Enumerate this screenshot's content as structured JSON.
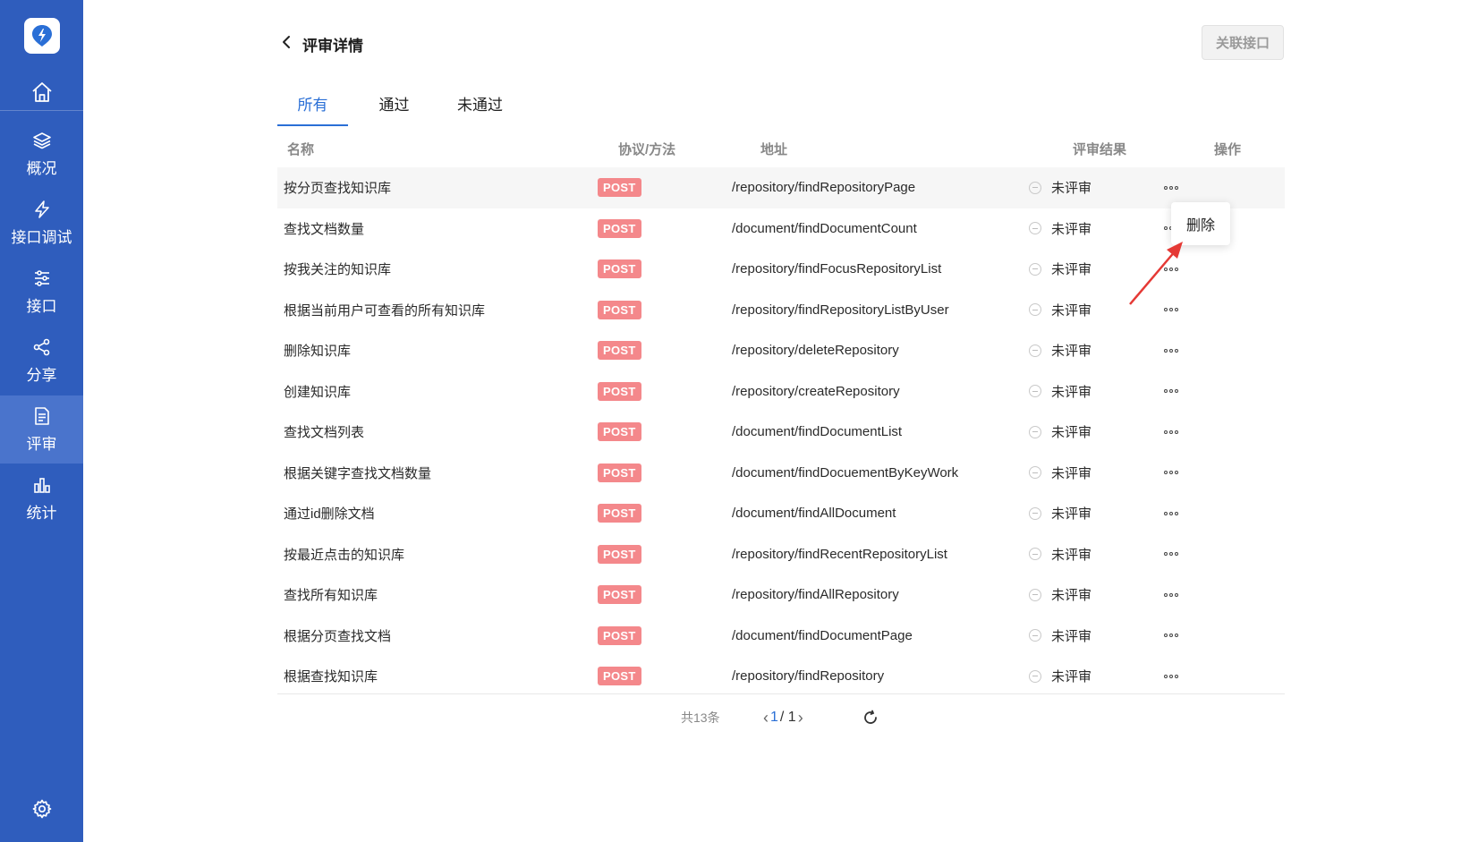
{
  "sidebar": {
    "items": [
      {
        "label": "概况",
        "icon": "layers-icon"
      },
      {
        "label": "接口调试",
        "icon": "lightning-icon"
      },
      {
        "label": "接口",
        "icon": "sliders-icon"
      },
      {
        "label": "分享",
        "icon": "share-icon"
      },
      {
        "label": "评审",
        "icon": "document-list-icon"
      },
      {
        "label": "统计",
        "icon": "bar-chart-icon"
      }
    ],
    "active_item": "评审"
  },
  "header": {
    "title": "评审详情",
    "link_button_label": "关联接口"
  },
  "tabs": [
    "所有",
    "通过",
    "未通过"
  ],
  "active_tab": "所有",
  "table": {
    "headers": {
      "name": "名称",
      "method": "协议/方法",
      "address": "地址",
      "result": "评审结果",
      "action": "操作"
    },
    "rows": [
      {
        "name": "按分页查找知识库",
        "method": "POST",
        "address": "/repository/findRepositoryPage",
        "result": "未评审"
      },
      {
        "name": "查找文档数量",
        "method": "POST",
        "address": "/document/findDocumentCount",
        "result": "未评审"
      },
      {
        "name": "按我关注的知识库",
        "method": "POST",
        "address": "/repository/findFocusRepositoryList",
        "result": "未评审"
      },
      {
        "name": "根据当前用户可查看的所有知识库",
        "method": "POST",
        "address": "/repository/findRepositoryListByUser",
        "result": "未评审"
      },
      {
        "name": "删除知识库",
        "method": "POST",
        "address": "/repository/deleteRepository",
        "result": "未评审"
      },
      {
        "name": "创建知识库",
        "method": "POST",
        "address": "/repository/createRepository",
        "result": "未评审"
      },
      {
        "name": "查找文档列表",
        "method": "POST",
        "address": "/document/findDocumentList",
        "result": "未评审"
      },
      {
        "name": "根据关键字查找文档数量",
        "method": "POST",
        "address": "/document/findDocuementByKeyWork",
        "result": "未评审"
      },
      {
        "name": "通过id删除文档",
        "method": "POST",
        "address": "/document/findAllDocument",
        "result": "未评审"
      },
      {
        "name": "按最近点击的知识库",
        "method": "POST",
        "address": "/repository/findRecentRepositoryList",
        "result": "未评审"
      },
      {
        "name": "查找所有知识库",
        "method": "POST",
        "address": "/repository/findAllRepository",
        "result": "未评审"
      },
      {
        "name": "根据分页查找文档",
        "method": "POST",
        "address": "/document/findDocumentPage",
        "result": "未评审"
      },
      {
        "name": "根据查找知识库",
        "method": "POST",
        "address": "/repository/findRepository",
        "result": "未评审"
      }
    ]
  },
  "pagination": {
    "total": "共13条",
    "current": "1",
    "separator": "/ 1"
  },
  "popover": {
    "delete_label": "删除"
  },
  "colors": {
    "sidebar": "#2f5dbd",
    "sidebar_active": "#4a74cc",
    "accent": "#2a6fd6",
    "post_badge": "#f4888b",
    "annotation_arrow": "#e53935"
  }
}
